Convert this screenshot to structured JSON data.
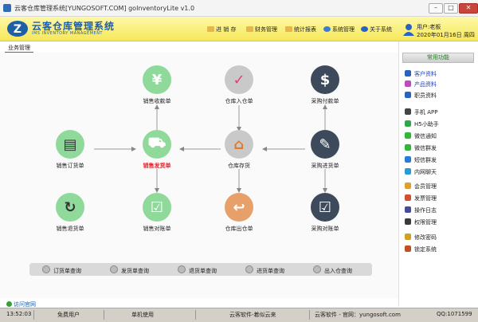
{
  "window": {
    "title": "云客仓库管理系统[YUNGOSOFT.COM]  goInventoryLite v1.0",
    "minimize": "–",
    "maximize": "□",
    "close": "✕"
  },
  "header": {
    "brand": "云客仓库管理系统",
    "brand_sub": "IMS INVENTORY MANAGEMENT",
    "menus": [
      {
        "label": "进 销 存",
        "icon": "folder-icon",
        "color": "#e8b548"
      },
      {
        "label": "财务管理",
        "icon": "folder-icon",
        "color": "#e8b548"
      },
      {
        "label": "统计报表",
        "icon": "folder-icon",
        "color": "#e8b548"
      },
      {
        "label": "系统管理",
        "icon": "settings-icon",
        "color": "#3a7bd5"
      },
      {
        "label": "关于系统",
        "icon": "help-icon",
        "color": "#2a62c0"
      }
    ],
    "user": {
      "name_line": "用户:老板",
      "date_line": "2020年01月16日 周四"
    }
  },
  "tab": {
    "label": "业务管理"
  },
  "flow": {
    "nodes": {
      "sales_receipt": {
        "label": "销售收款单",
        "icon": "yen-icon",
        "glyph": "¥",
        "color": "#8fd99a"
      },
      "stock_in": {
        "label": "仓库入仓单",
        "icon": "checked-calendar-icon",
        "glyph": "✓",
        "color": "#c9c9c9"
      },
      "purchase_payment": {
        "label": "采购付款单",
        "icon": "payment-bag-icon",
        "glyph": "$",
        "color": "#3d4a5c"
      },
      "sales_order": {
        "label": "销售订货单",
        "icon": "clipboard-icon",
        "glyph": "▤",
        "color": "#8fd99a"
      },
      "sales_delivery": {
        "label": "销售发货单",
        "icon": "delivery-truck-icon",
        "glyph": "⛟",
        "color": "#8fd99a"
      },
      "warehouse_stock": {
        "label": "仓库存货",
        "icon": "home-icon",
        "glyph": "⌂",
        "color": "#c9c9c9"
      },
      "purchase_in": {
        "label": "采购进货单",
        "icon": "signed-document-icon",
        "glyph": "✎",
        "color": "#3d4a5c"
      },
      "sales_return": {
        "label": "销售退货单",
        "icon": "refresh-icon",
        "glyph": "↻",
        "color": "#8fd99a"
      },
      "sales_statement": {
        "label": "销售对账单",
        "icon": "checklist-icon",
        "glyph": "☑",
        "color": "#8fd99a"
      },
      "stock_out": {
        "label": "仓库出仓单",
        "icon": "return-box-icon",
        "glyph": "↩",
        "color": "#e7a06a"
      },
      "purchase_statement": {
        "label": "采购对账单",
        "icon": "checklist-icon",
        "glyph": "☑",
        "color": "#3d4a5c"
      }
    }
  },
  "query_bar": [
    {
      "label": "订货单查询"
    },
    {
      "label": "发货单查询"
    },
    {
      "label": "退货单查询"
    },
    {
      "label": "进货单查询"
    },
    {
      "label": "出入仓查询"
    }
  ],
  "visit_link": "访问官网",
  "sidebar": {
    "title": "常用功能",
    "items": [
      {
        "label": "客户资料",
        "icon": "customers-icon",
        "color": "#2a62c0",
        "link": true
      },
      {
        "label": "产品资料",
        "icon": "products-icon",
        "color": "#c04ac0",
        "link": true
      },
      {
        "label": "职员资料",
        "icon": "staff-icon",
        "color": "#2a62c0",
        "link": false
      },
      {
        "label": "手机 APP",
        "icon": "phone-icon",
        "color": "#444444",
        "link": false
      },
      {
        "label": "H5小助手",
        "icon": "check-circle-icon",
        "color": "#2fa84a",
        "link": false
      },
      {
        "label": "微信通知",
        "icon": "wechat-icon",
        "color": "#2fb83a",
        "link": false
      },
      {
        "label": "微信群发",
        "icon": "wechat-icon",
        "color": "#2fb83a",
        "link": false
      },
      {
        "label": "短信群发",
        "icon": "sms-icon",
        "color": "#2a7bd5",
        "link": false
      },
      {
        "label": "内网聊天",
        "icon": "chat-icon",
        "color": "#2a9bd5",
        "link": false
      },
      {
        "label": "会员管理",
        "icon": "member-icon",
        "color": "#e0a030",
        "link": false
      },
      {
        "label": "发票管理",
        "icon": "invoice-icon",
        "color": "#d05030",
        "link": false
      },
      {
        "label": "操作日志",
        "icon": "log-icon",
        "color": "#4a4a9a",
        "link": false
      },
      {
        "label": "权限管理",
        "icon": "permission-icon",
        "color": "#3a3a3a",
        "link": false
      },
      {
        "label": "修改密码",
        "icon": "key-icon",
        "color": "#d0a020",
        "link": false
      },
      {
        "label": "锁定系统",
        "icon": "lock-icon",
        "color": "#c05020",
        "link": false
      }
    ]
  },
  "status": {
    "time": "13:52:03",
    "user_type": "免费用户",
    "mode": "单机使用",
    "slogan": "云客软件-着似云来",
    "site": "云客软件 - 官网：yungosoft.com",
    "qq": "QQ:1071599"
  }
}
